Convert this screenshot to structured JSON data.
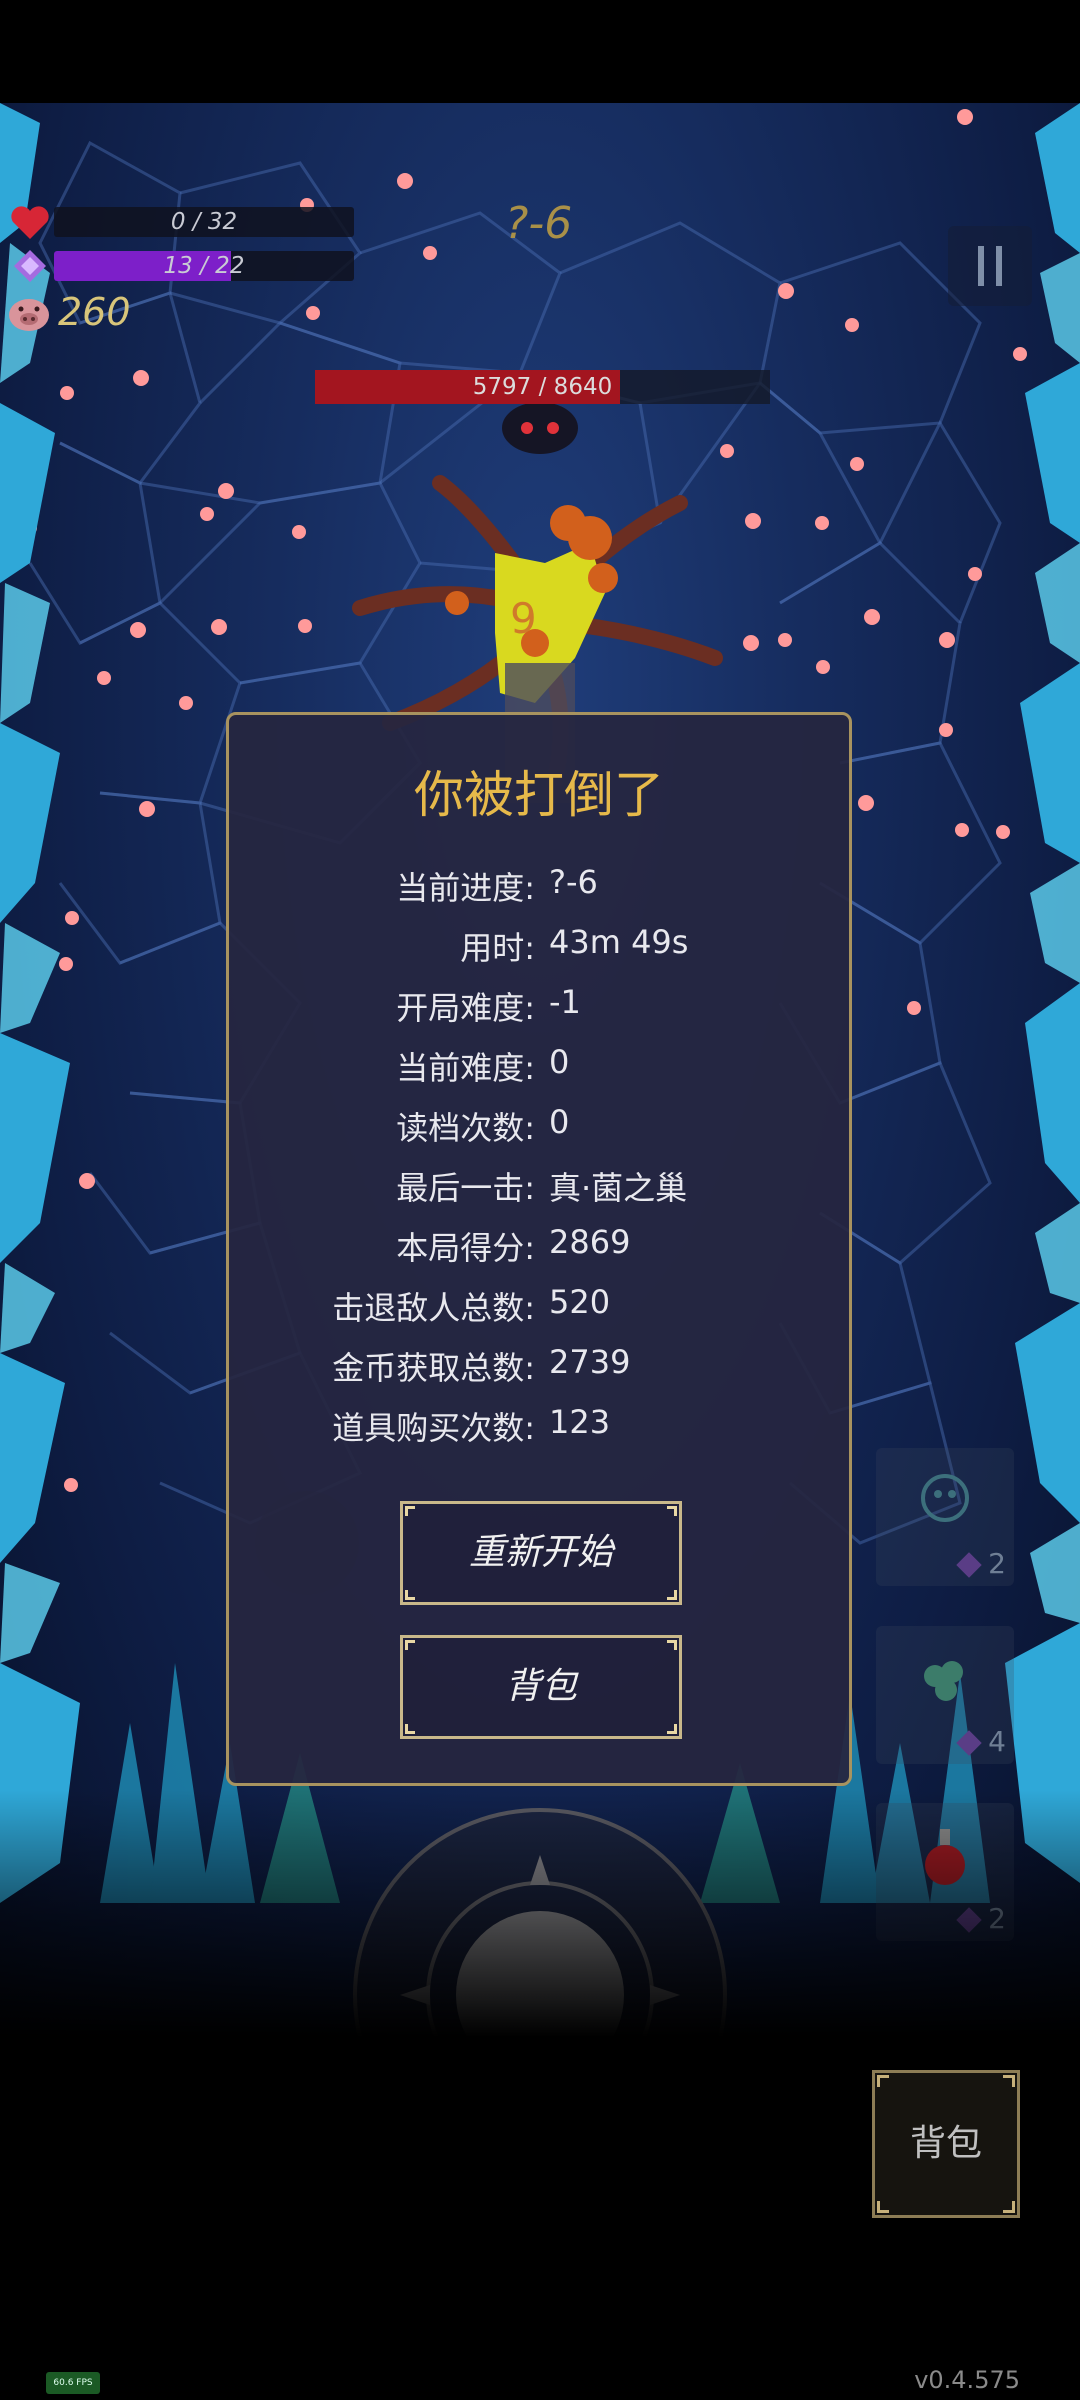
{
  "hud": {
    "hp_text": "0 / 32",
    "hp_fraction": 0.0,
    "mp_text": "13 / 22",
    "mp_fraction": 0.59,
    "coins": "260",
    "level": "?-6",
    "pause_icon": "pause-icon"
  },
  "boss": {
    "hp_text": "5797 / 8640",
    "hp_fraction": 0.67,
    "damage_number": "9"
  },
  "dialog": {
    "title": "你被打倒了",
    "stats": [
      {
        "label": "当前进度:",
        "value": "?-6"
      },
      {
        "label": "用时:",
        "value": "43m 49s"
      },
      {
        "label": "开局难度:",
        "value": "-1"
      },
      {
        "label": "当前难度:",
        "value": "0"
      },
      {
        "label": "读档次数:",
        "value": "0"
      },
      {
        "label": "最后一击:",
        "value": "真·菌之巢"
      },
      {
        "label": "本局得分:",
        "value": "2869"
      },
      {
        "label": "击退敌人总数:",
        "value": "520"
      },
      {
        "label": "金币获取总数:",
        "value": "2739"
      },
      {
        "label": "道具购买次数:",
        "value": "123"
      }
    ],
    "restart_label": "重新开始",
    "bag_label": "背包"
  },
  "inventory": {
    "slots": [
      {
        "icon": "creature-icon",
        "count": "2"
      },
      {
        "icon": "egg-cluster-icon",
        "count": "4"
      },
      {
        "icon": "potion-icon",
        "count": "2"
      }
    ]
  },
  "bag_button_label": "背包",
  "fps": "60.6 FPS",
  "version": "v0.4.575",
  "colors": {
    "title_gold": "#e6b94a",
    "dialog_border": "#a8935f",
    "mana_purple": "#7d1fc9",
    "boss_hp_red": "#a3151f"
  }
}
